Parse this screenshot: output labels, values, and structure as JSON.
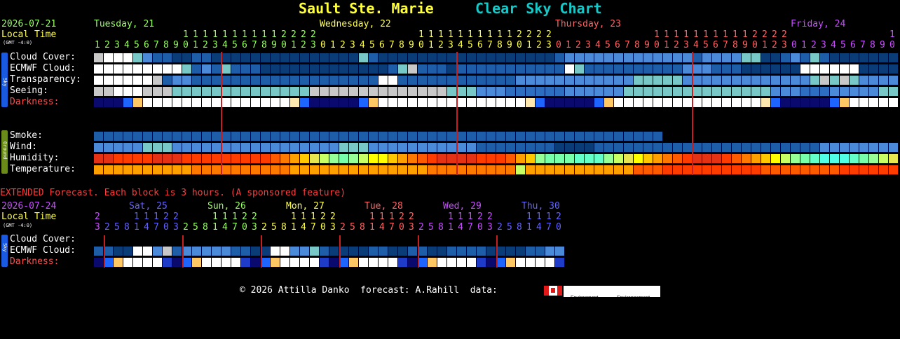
{
  "header": {
    "location": "Sault Ste. Marie",
    "title": "Clear Sky Chart",
    "location_color": "#ffff3c",
    "title_color": "#16c8c8"
  },
  "main": {
    "date": "2026-07-21",
    "local_time_label": "Local Time",
    "gmt_label": "(GMT -4:0)",
    "days": [
      {
        "label": "Tuesday, 21",
        "color": "#9aff64"
      },
      {
        "label": "Wednesday, 22",
        "color": "#ffff50"
      },
      {
        "label": "Thursday, 23",
        "color": "#ff6464"
      },
      {
        "label": "Friday, 24",
        "color": "#c850ff"
      }
    ],
    "sky_tab": "Sky",
    "ground_tab": "Ground",
    "rows": {
      "cloud_cover": "Cloud Cover:",
      "ecmwf_cloud": "ECMWF Cloud:",
      "transparency": "Transparency:",
      "seeing": "Seeing:",
      "darkness": "Darkness:",
      "smoke": "Smoke:",
      "wind": "Wind:",
      "humidity": "Humidity:",
      "temperature": "Temperature:"
    }
  },
  "extended": {
    "banner": "EXTENDED Forecast. Each block is 3 hours. (A sponsored feature)",
    "date": "2026-07-24",
    "local_time_label": "Local Time",
    "gmt_label": "(GMT -4:0)",
    "days": [
      {
        "label": "Sat, 25",
        "color": "#6464ff"
      },
      {
        "label": "Sun, 26",
        "color": "#9aff64"
      },
      {
        "label": "Mon, 27",
        "color": "#ffff50"
      },
      {
        "label": "Tue, 28",
        "color": "#ff6464"
      },
      {
        "label": "Wed, 29",
        "color": "#c850ff"
      },
      {
        "label": "Thu, 30",
        "color": "#6464ff"
      }
    ],
    "sky_tab": "Sky",
    "rows": {
      "cloud_cover": "Cloud Cover:",
      "ecmwf_cloud": "ECMWF Cloud:",
      "darkness": "Darkness:"
    }
  },
  "footer": {
    "credit": "© 2026 Attilla Danko  forecast: A.Rahill  data:",
    "logo1_line1": "Environment",
    "logo1_line2": "Canada",
    "logo2_line1": "Environnement",
    "logo2_line2": "Canada"
  }
}
